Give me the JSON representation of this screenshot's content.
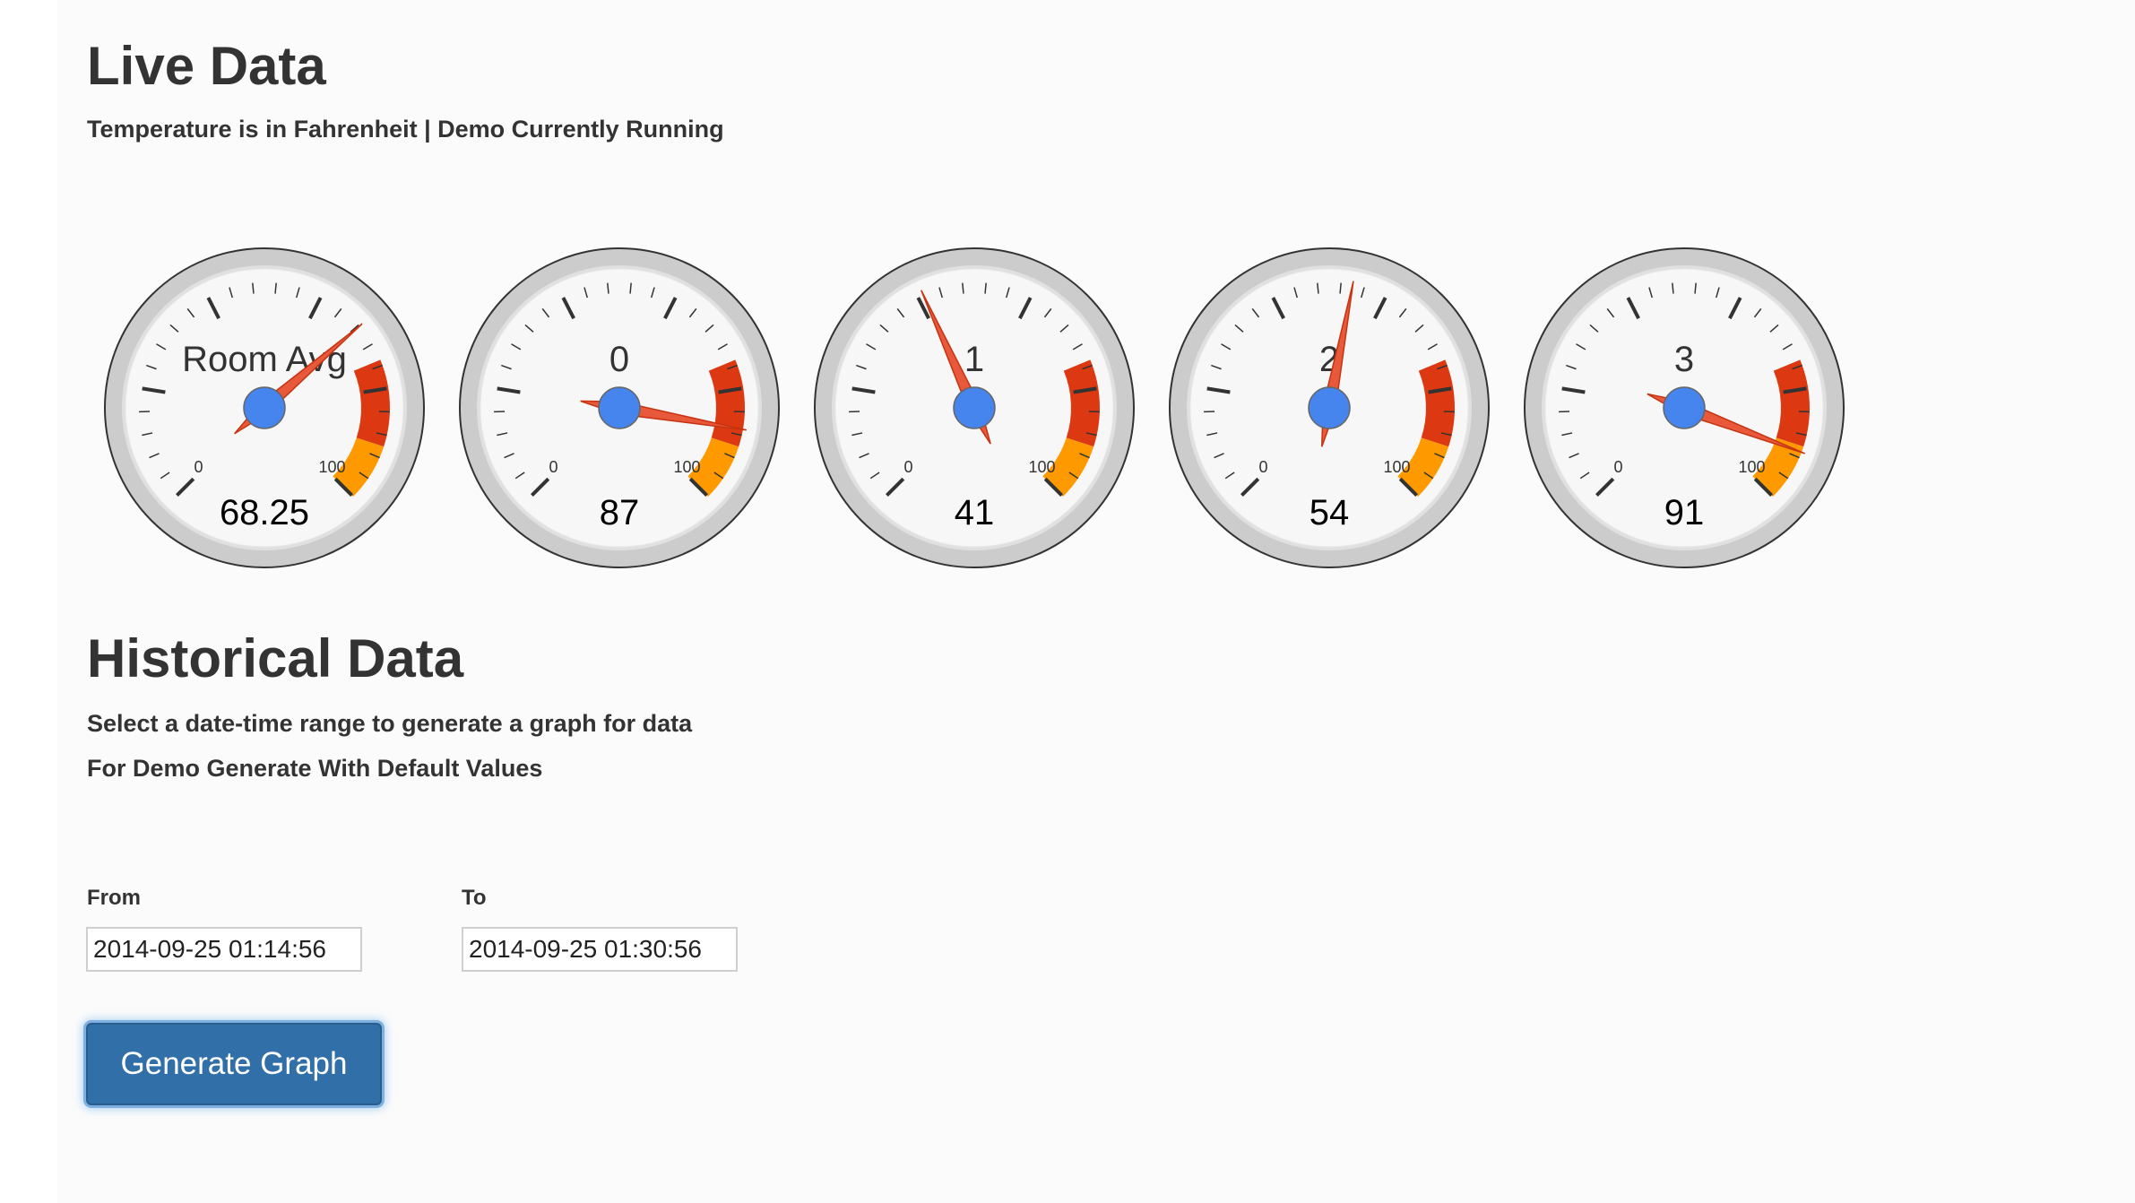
{
  "live": {
    "title": "Live Data",
    "subtitle": "Temperature is in Fahrenheit | Demo Currently Running"
  },
  "gauges": [
    {
      "label": "Room Avg",
      "value": 68.25,
      "display": "68.25",
      "min": 0,
      "max": 100,
      "min_label": "0",
      "max_label": "100"
    },
    {
      "label": "0",
      "value": 87,
      "display": "87",
      "min": 0,
      "max": 100,
      "min_label": "0",
      "max_label": "100"
    },
    {
      "label": "1",
      "value": 41,
      "display": "41",
      "min": 0,
      "max": 100,
      "min_label": "0",
      "max_label": "100"
    },
    {
      "label": "2",
      "value": 54,
      "display": "54",
      "min": 0,
      "max": 100,
      "min_label": "0",
      "max_label": "100"
    },
    {
      "label": "3",
      "value": 91,
      "display": "91",
      "min": 0,
      "max": 100,
      "min_label": "0",
      "max_label": "100"
    }
  ],
  "gauge_bands": [
    {
      "from": 75,
      "to": 90,
      "color": "#dc3912"
    },
    {
      "from": 90,
      "to": 100,
      "color": "#ff9900"
    }
  ],
  "colors": {
    "needle": "#e8583a",
    "hub": "#4684ee",
    "band_red": "#dc3912",
    "band_orange": "#ff9900",
    "button": "#306fa8"
  },
  "historical": {
    "title": "Historical Data",
    "line1": "Select a date-time range to generate a graph for data",
    "line2": "For Demo Generate With Default Values",
    "from_label": "From",
    "from_value": "2014-09-25 01:14:56",
    "to_label": "To",
    "to_value": "2014-09-25 01:30:56",
    "button_label": "Generate Graph"
  }
}
